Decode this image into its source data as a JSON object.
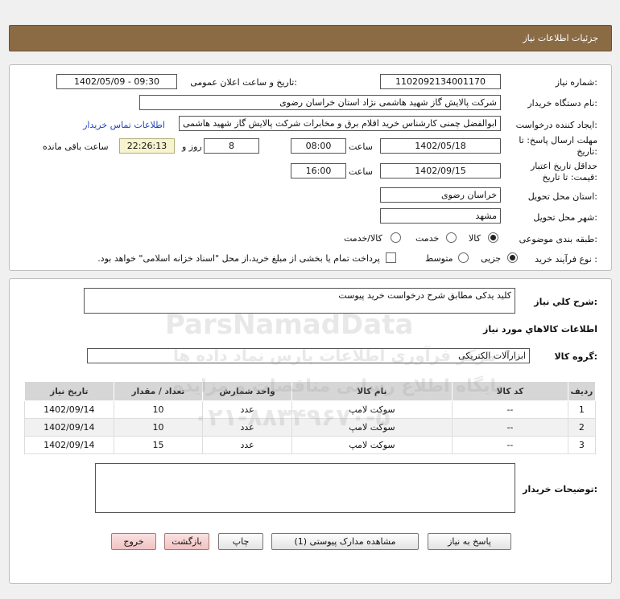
{
  "header": {
    "title": "جزئیات اطلاعات نیاز"
  },
  "form": {
    "need_number_label": "شماره نیاز:",
    "need_number": "1102092134001170",
    "announce_label": "تاریخ و ساعت اعلان عمومی:",
    "announce_value": "1402/05/09 - 09:30",
    "buyer_org_label": "نام دستگاه خریدار:",
    "buyer_org": "شرکت پالایش گاز شهید هاشمی نژاد   استان خراسان رضوی",
    "requester_label": "ایجاد کننده درخواست:",
    "requester": "ابوالفضل چمنی کارشناس خرید اقلام برق و مخابرات شرکت پالایش گاز شهید هاشمی نژاد",
    "contact_link": "اطلاعات تماس خریدار",
    "deadline_label": "مهلت ارسال پاسخ: تا تاریخ:",
    "deadline_date": "1402/05/18",
    "time_label": "ساعت",
    "deadline_time": "08:00",
    "days_count": "8",
    "days_label": "روز و",
    "remaining_time": "22:26:13",
    "remaining_label": "ساعت باقی مانده",
    "validity_label": "حداقل تاریخ اعتبار قیمت: تا تاریخ:",
    "validity_date": "1402/09/15",
    "validity_time_label": "ساعت",
    "validity_time": "16:00",
    "delivery_province_label": "استان محل تحویل:",
    "delivery_province": "خراسان رضوی",
    "delivery_city_label": "شهر محل تحویل:",
    "delivery_city": "مشهد",
    "category_label": "طبقه بندی موضوعی:",
    "category_options": [
      "کالا",
      "خدمت",
      "کالا/خدمت"
    ],
    "purchase_type_label": "نوع فرآیند خرید :",
    "purchase_options": [
      "جزیی",
      "متوسط"
    ],
    "payment_note": "پرداخت تمام یا بخشی از مبلغ خرید،از محل \"اسناد خزانه اسلامی\" خواهد بود."
  },
  "details": {
    "summary_label": "شرح کلي نياز:",
    "summary": "کلید یدکی مطابق شرح درخواست خرید پیوست",
    "goods_info_title": "اطلاعات کالاهاي مورد نياز",
    "goods_group_label": "گروه کالا:",
    "goods_group": "ابزارآلات الکتریکی",
    "table": {
      "headers": [
        "ردیف",
        "کد کالا",
        "نام کالا",
        "واحد شمارش",
        "تعداد / مقدار",
        "تاریخ نیاز"
      ],
      "rows": [
        [
          "1",
          "--",
          "سوکت لامپ",
          "عدد",
          "10",
          "1402/09/14"
        ],
        [
          "2",
          "--",
          "سوکت لامپ",
          "عدد",
          "10",
          "1402/09/14"
        ],
        [
          "3",
          "--",
          "سوکت لامپ",
          "عدد",
          "15",
          "1402/09/14"
        ]
      ]
    },
    "buyer_notes_label": "توضیحات خریدار:",
    "buyer_notes": ""
  },
  "buttons": {
    "reply": "پاسخ به نیاز",
    "attachments": "مشاهده مدارک پیوستی (1)",
    "print": "چاپ",
    "back": "بازگشت",
    "exit": "خروج"
  },
  "watermark": {
    "brand": "ParsNamadData",
    "line1": "مرکز فرآوری اطلاعات پارس نماد داده ها",
    "line2": "پایگاه اطلاع رسانی مناقصات و مزایده",
    "phone": "۰۲۱-۸۸۳۴۹۶۷۰-۵"
  },
  "colors": {
    "header_bg": "#8a6b44",
    "link": "#2244bb",
    "remaining_bg": "#f6f3cf",
    "exit_bg": "#f1c2c2"
  }
}
